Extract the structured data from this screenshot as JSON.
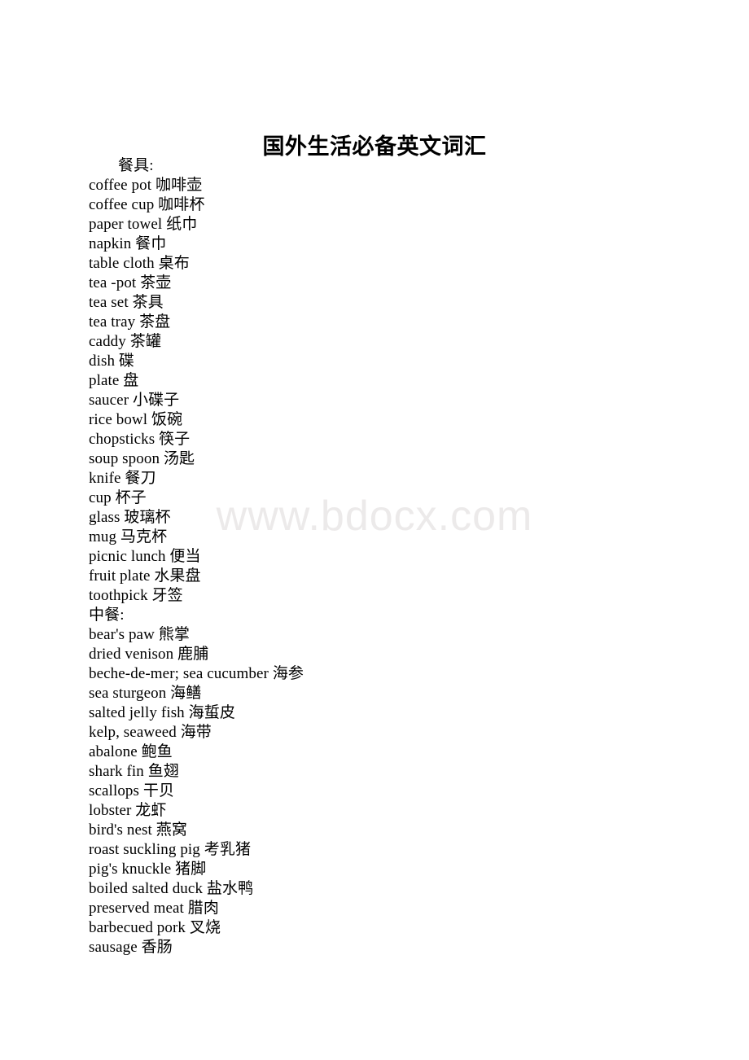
{
  "document": {
    "title": "国外生活必备英文词汇",
    "watermark": "www.bdocx.com",
    "lines": [
      {
        "text": "餐具:",
        "indent": true,
        "kind": "section-heading"
      },
      {
        "text": "coffee pot 咖啡壶",
        "indent": false,
        "kind": "entry"
      },
      {
        "text": "coffee cup 咖啡杯",
        "indent": false,
        "kind": "entry"
      },
      {
        "text": "paper towel 纸巾",
        "indent": false,
        "kind": "entry"
      },
      {
        "text": "napkin 餐巾",
        "indent": false,
        "kind": "entry"
      },
      {
        "text": "table cloth 桌布",
        "indent": false,
        "kind": "entry"
      },
      {
        "text": "tea -pot 茶壶",
        "indent": false,
        "kind": "entry"
      },
      {
        "text": "tea set 茶具",
        "indent": false,
        "kind": "entry"
      },
      {
        "text": "tea tray 茶盘",
        "indent": false,
        "kind": "entry"
      },
      {
        "text": "caddy 茶罐",
        "indent": false,
        "kind": "entry"
      },
      {
        "text": "dish 碟",
        "indent": false,
        "kind": "entry"
      },
      {
        "text": "plate 盘",
        "indent": false,
        "kind": "entry"
      },
      {
        "text": "saucer 小碟子",
        "indent": false,
        "kind": "entry"
      },
      {
        "text": "rice bowl 饭碗",
        "indent": false,
        "kind": "entry"
      },
      {
        "text": "chopsticks 筷子",
        "indent": false,
        "kind": "entry"
      },
      {
        "text": "soup spoon 汤匙",
        "indent": false,
        "kind": "entry"
      },
      {
        "text": "knife 餐刀",
        "indent": false,
        "kind": "entry"
      },
      {
        "text": "cup 杯子",
        "indent": false,
        "kind": "entry"
      },
      {
        "text": "glass 玻璃杯",
        "indent": false,
        "kind": "entry"
      },
      {
        "text": "mug 马克杯",
        "indent": false,
        "kind": "entry"
      },
      {
        "text": "picnic lunch 便当",
        "indent": false,
        "kind": "entry"
      },
      {
        "text": "fruit plate 水果盘",
        "indent": false,
        "kind": "entry"
      },
      {
        "text": "toothpick 牙签",
        "indent": false,
        "kind": "entry"
      },
      {
        "text": "中餐:",
        "indent": false,
        "kind": "section-heading"
      },
      {
        "text": "bear's paw 熊掌",
        "indent": false,
        "kind": "entry"
      },
      {
        "text": "dried venison 鹿脯",
        "indent": false,
        "kind": "entry"
      },
      {
        "text": "beche-de-mer; sea cucumber 海参",
        "indent": false,
        "kind": "entry"
      },
      {
        "text": "sea sturgeon 海鳝",
        "indent": false,
        "kind": "entry"
      },
      {
        "text": "salted jelly fish 海蜇皮",
        "indent": false,
        "kind": "entry"
      },
      {
        "text": "kelp, seaweed 海带",
        "indent": false,
        "kind": "entry"
      },
      {
        "text": "abalone 鲍鱼",
        "indent": false,
        "kind": "entry"
      },
      {
        "text": "shark fin 鱼翅",
        "indent": false,
        "kind": "entry"
      },
      {
        "text": "scallops 干贝",
        "indent": false,
        "kind": "entry"
      },
      {
        "text": "lobster 龙虾",
        "indent": false,
        "kind": "entry"
      },
      {
        "text": "bird's nest 燕窝",
        "indent": false,
        "kind": "entry"
      },
      {
        "text": "roast suckling pig 考乳猪",
        "indent": false,
        "kind": "entry"
      },
      {
        "text": "pig's knuckle 猪脚",
        "indent": false,
        "kind": "entry"
      },
      {
        "text": "boiled salted duck 盐水鸭",
        "indent": false,
        "kind": "entry"
      },
      {
        "text": "preserved meat 腊肉",
        "indent": false,
        "kind": "entry"
      },
      {
        "text": "barbecued pork 叉烧",
        "indent": false,
        "kind": "entry"
      },
      {
        "text": "sausage 香肠",
        "indent": false,
        "kind": "entry"
      }
    ]
  }
}
